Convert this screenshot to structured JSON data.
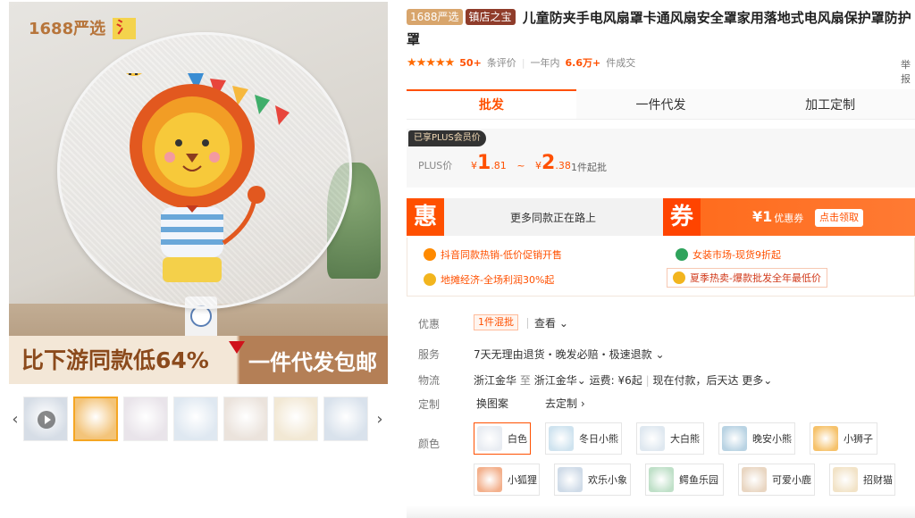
{
  "gallery": {
    "yanxuan_tag": "1688严选",
    "logo_mark": "氵",
    "banner_left": "比下游同款低64%",
    "banner_right": "一件代发包邮",
    "prev_icon": "‹",
    "next_icon": "›"
  },
  "product": {
    "badge_yanxuan": "1688严选",
    "badge_store": "镇店之宝",
    "title": "儿童防夹手电风扇罩卡通风扇安全罩家用落地式电风扇保护罩防护罩"
  },
  "rating": {
    "stars": "★★★★★",
    "review_count": "50+",
    "review_label": "条评价",
    "year_label": "一年内",
    "sales": "6.6万+",
    "sales_label": "件成交",
    "share": "举报"
  },
  "tabs": [
    "批发",
    "一件代发",
    "加工定制"
  ],
  "price": {
    "plus_tag": "已享PLUS会员价",
    "plus_label": "PLUS价",
    "currency": "¥",
    "low_int": "1",
    "low_dec": ".81",
    "tilde": "~",
    "high_int": "2",
    "high_dec": ".38",
    "min_order": "1件起批"
  },
  "promo": {
    "hui": "惠",
    "left_text": "更多同款正在路上",
    "quan": "券",
    "coupon_amount": "¥1",
    "coupon_label": "优惠券",
    "coupon_button": "点击领取"
  },
  "activities": [
    "抖音同款热销-低价促销开售",
    "女装市场-现货9折起",
    "地摊经济-全场利润30%起",
    "夏季热卖-爆款批发全年最低价"
  ],
  "attrs": {
    "discount_label": "优惠",
    "mixed_batch": "1件混批",
    "view": "查看",
    "service_label": "服务",
    "service_value": "7天无理由退货・晚发必赔・极速退款",
    "logistics_label": "物流",
    "from": "浙江金华",
    "to_word": "至",
    "to": "浙江金华",
    "freight": "运费: ¥6起",
    "delivery": "现在付款，后天达",
    "more": "更多",
    "custom_label": "定制",
    "custom_pattern": "换图案",
    "custom_go": "去定制",
    "color_label": "颜色"
  },
  "colors": [
    {
      "label": "白色",
      "tint": "#e8ecf2"
    },
    {
      "label": "冬日小熊",
      "tint": "#cfe3ef"
    },
    {
      "label": "大白熊",
      "tint": "#dfe8f0"
    },
    {
      "label": "晚安小熊",
      "tint": "#b9d3e3"
    },
    {
      "label": "小狮子",
      "tint": "#f6c26b"
    },
    {
      "label": "小狐狸",
      "tint": "#f3b08c"
    },
    {
      "label": "欢乐小象",
      "tint": "#cfdbe8"
    },
    {
      "label": "鳄鱼乐园",
      "tint": "#bfe0c8"
    },
    {
      "label": "可爱小鹿",
      "tint": "#e9d6c2"
    },
    {
      "label": "招财猫",
      "tint": "#f2e3c7"
    }
  ],
  "thumb_tints": [
    "#d6dde6",
    "#f3c47a",
    "#e9e4ea",
    "#dfe8f1",
    "#ebe3dc",
    "#f2e8d4",
    "#d9e2ec",
    "#eef1f4"
  ],
  "accent": "#ff5000"
}
